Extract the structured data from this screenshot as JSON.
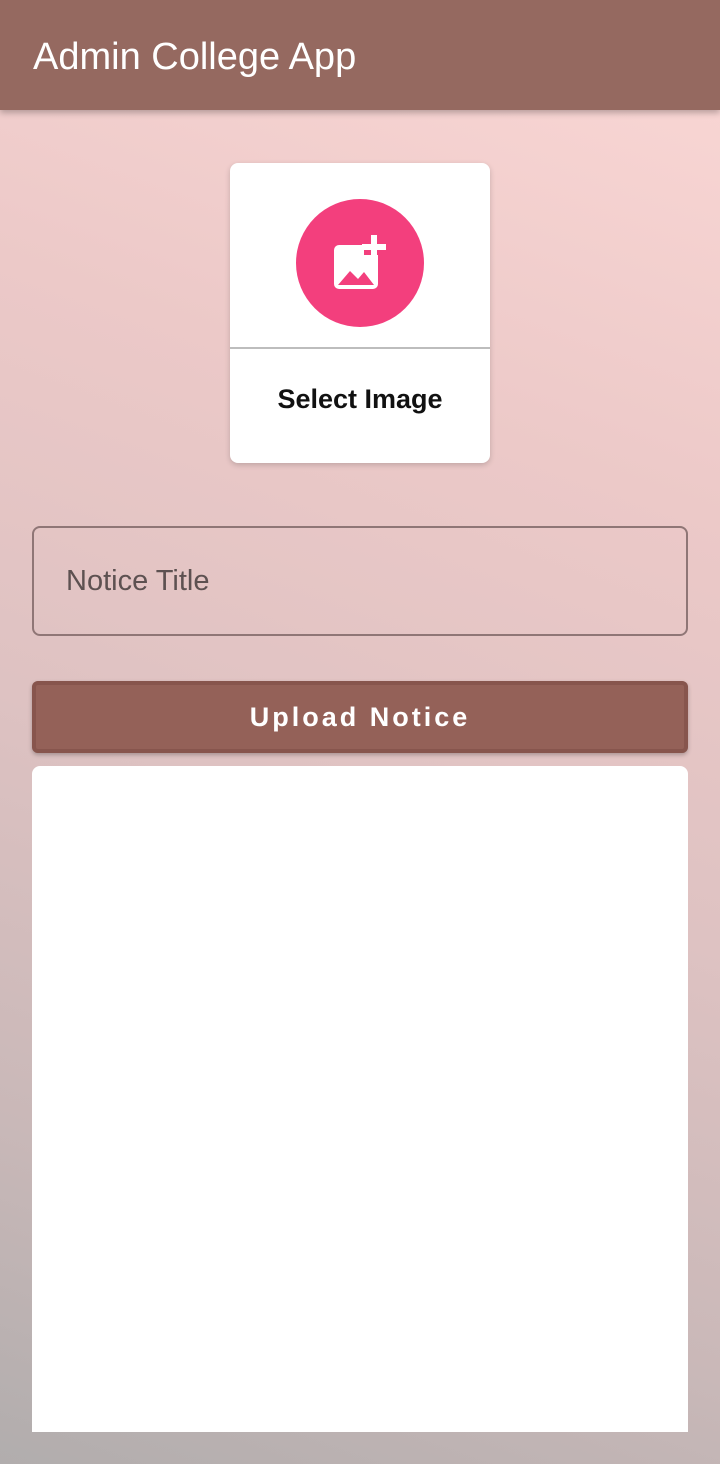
{
  "app_bar": {
    "title": "Admin College App",
    "color": "#956960"
  },
  "image_picker": {
    "icon": "add-photo-icon",
    "icon_color": "#f33f7d",
    "label": "Select Image"
  },
  "notice_form": {
    "title_placeholder": "Notice Title",
    "title_value": "",
    "upload_label": "Upload Notice",
    "upload_color": "#946158"
  }
}
